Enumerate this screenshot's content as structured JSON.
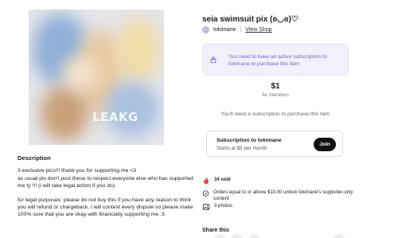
{
  "listing": {
    "title": "seia swimsuit pix (ʚ◡ɞ)♡",
    "watermark": "LEAKG",
    "creator_name": "tokimane",
    "view_shop_label": "View Shop"
  },
  "notice": {
    "text": "You need to have an active subscription to tokimane to purchase this item",
    "icon": "lock-icon"
  },
  "price": {
    "amount": "$1",
    "subtitle": "for members",
    "requirement": "You'll need a subscription to purchase this item"
  },
  "subscription": {
    "title": "Subscription to tokimane",
    "price_text": "Starts at $5 per month",
    "join_label": "Join"
  },
  "meta": {
    "sold": "34 sold",
    "offer": "Orders equal to or above $10.00 unlock tokimane's supporter-only content",
    "photos": "3 photos"
  },
  "description": {
    "heading": "Description",
    "p1_line1": "3 exclusive pics!!! thank you for supporting me <3",
    "p1_line2": "as usual pls don't post these to respect everyone else who has supported me ty !!! (i will take legal action if you do).",
    "p2": "for legal purposes: please do not buy this if you have any reason to think you will refund or chargeback. i will contest every dispute so please make 100% sure that you are okay with financially supporting me :3"
  },
  "share": {
    "label": "Share this"
  },
  "colors": {
    "accent": "#6b63d8",
    "notice_bg": "#f1f1fb",
    "fire": "#e8453c"
  }
}
